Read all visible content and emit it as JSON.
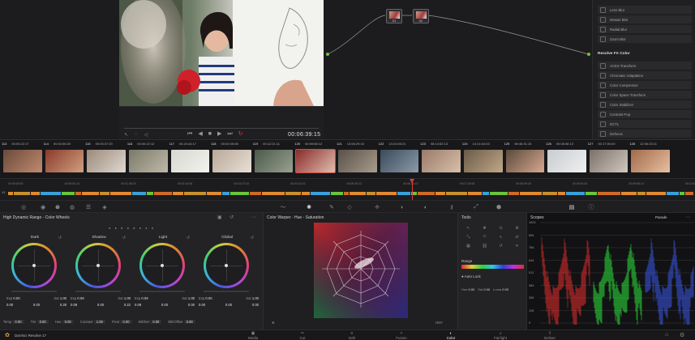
{
  "viewer": {
    "timecode": "00:06:39:15"
  },
  "nodes": [
    {
      "label": "01"
    },
    {
      "label": "02"
    }
  ],
  "fx_library": {
    "items_top": [
      "Lens Blur",
      "Mosaic Blur",
      "Radial Blur",
      "Zoom Blur"
    ],
    "section": "Resolve FX Color",
    "items": [
      "ACES Transform",
      "Chromatic Adaptation",
      "Color Compressor",
      "Color Space Transform",
      "Color Stabilizer",
      "Contrast Pop",
      "DCTL",
      "Defocus"
    ]
  },
  "clips": [
    {
      "num": "113",
      "tc": "00:03:22:17"
    },
    {
      "num": "114",
      "tc": "00:04:56:20"
    },
    {
      "num": "115",
      "tc": "00:03:37:20"
    },
    {
      "num": "116",
      "tc": "00:00:22:12"
    },
    {
      "num": "117",
      "tc": "04:24:44:17"
    },
    {
      "num": "118",
      "tc": "00:02:05:08"
    },
    {
      "num": "119",
      "tc": "00:12:21:11"
    },
    {
      "num": "120",
      "tc": "00:59:58:12"
    },
    {
      "num": "121",
      "tc": "13:06:29:16"
    },
    {
      "num": "122",
      "tc": "13:24:05:21"
    },
    {
      "num": "123",
      "tc": "08:14:52:13"
    },
    {
      "num": "124",
      "tc": "14:14:04:03"
    },
    {
      "num": "125",
      "tc": "08:46:31:15"
    },
    {
      "num": "126",
      "tc": "00:08:46:13"
    },
    {
      "num": "127",
      "tc": "00:17:00:00"
    },
    {
      "num": "128",
      "tc": "12:06:23:11"
    }
  ],
  "timeline": {
    "track": "V1",
    "ticks": [
      "00:00:00:00",
      "00:00:04:10",
      "00:01:48:20",
      "00:02:43:08",
      "00:03:37:16",
      "00:04:32:02",
      "00:05:26:12",
      "00:06:20:22",
      "00:07:15:08",
      "00:08:09:18",
      "00:09:04:04",
      "00:09:58:14",
      "00:10:52:00"
    ]
  },
  "wheels_panel": {
    "title": "High Dynamic Range - Color Wheels",
    "wheels": [
      {
        "name": "Dark",
        "exp": "0.00",
        "sat": "1.00",
        "x": "0.00",
        "y": "0.00",
        "z": "0.28"
      },
      {
        "name": "Shadow",
        "exp": "0.09",
        "sat": "1.00",
        "x": "0.09",
        "y": "0.00",
        "z": "0.22"
      },
      {
        "name": "Light",
        "exp": "0.09",
        "sat": "1.00",
        "x": "0.09",
        "y": "0.00",
        "z": "0.00"
      },
      {
        "name": "Global",
        "exp": "0.00",
        "sat": "1.00",
        "x": "0.00",
        "y": "0.00",
        "z": "0.00"
      }
    ],
    "labels": {
      "exp": "Exp",
      "sat": "Sat"
    },
    "params": [
      {
        "label": "Temp",
        "value": "0.00"
      },
      {
        "label": "Tint",
        "value": "0.00"
      },
      {
        "label": "Hue",
        "value": "0.00"
      },
      {
        "label": "Contrast",
        "value": "1.00"
      },
      {
        "label": "Pivot",
        "value": "0.00"
      },
      {
        "label": "Md/Det",
        "value": "0.00"
      },
      {
        "label": "Blk/Offset",
        "value": "0.00"
      }
    ]
  },
  "warper_panel": {
    "title": "Color Warper - Hue - Saturation",
    "mode": "HSV"
  },
  "tools_panel": {
    "title": "Tools",
    "range_label": "Range",
    "auto_lock": "Auto Lock",
    "fields": [
      {
        "label": "Hue",
        "value": "0.00"
      },
      {
        "label": "Sat",
        "value": "0.00"
      },
      {
        "label": "Luma",
        "value": "0.00"
      }
    ]
  },
  "scopes_panel": {
    "title": "Scopes",
    "mode": "Parade",
    "scale": [
      "1023",
      "896",
      "768",
      "640",
      "512",
      "384",
      "256",
      "128",
      "0"
    ]
  },
  "page_bar": {
    "app_name": "DaVinci Resolve 17",
    "pages": [
      {
        "name": "Media",
        "icon": "▣"
      },
      {
        "name": "Cut",
        "icon": "✂"
      },
      {
        "name": "Edit",
        "icon": "≡"
      },
      {
        "name": "Fusion",
        "icon": "✧"
      },
      {
        "name": "Color",
        "icon": "◐"
      },
      {
        "name": "Fairlight",
        "icon": "♫"
      },
      {
        "name": "Deliver",
        "icon": "⇪"
      }
    ],
    "active": "Color"
  },
  "colors": {
    "accent": "#e03b3b",
    "node_port": "#6ac43c"
  }
}
